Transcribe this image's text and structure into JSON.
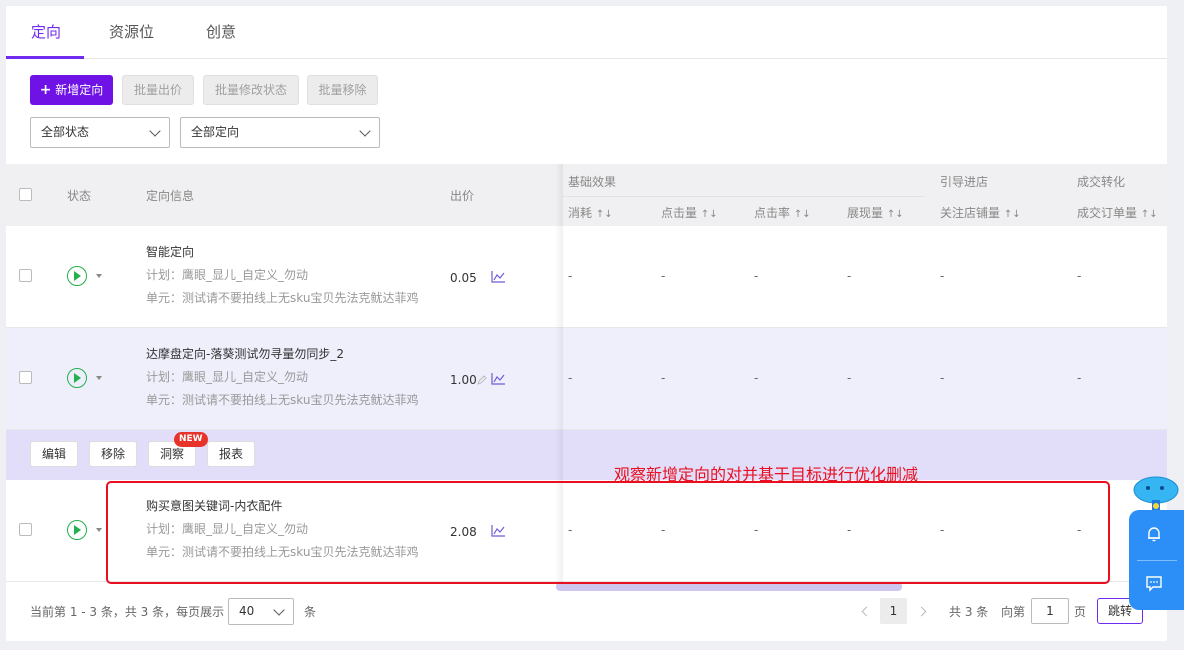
{
  "tabs": [
    {
      "label": "定向",
      "active": true
    },
    {
      "label": "资源位",
      "active": false
    },
    {
      "label": "创意",
      "active": false
    }
  ],
  "toolbar": {
    "add_label": "新增定向",
    "batch_bid": "批量出价",
    "batch_status": "批量修改状态",
    "batch_remove": "批量移除"
  },
  "filters": {
    "status_select": "全部状态",
    "targeting_select": "全部定向"
  },
  "table_header": {
    "status": "状态",
    "info": "定向信息",
    "bid": "出价",
    "group_basic": "基础效果",
    "group_guide": "引导进店",
    "group_conversion": "成交转化",
    "cost": "消耗",
    "clicks": "点击量",
    "ctr": "点击率",
    "impressions": "展现量",
    "follows": "关注店铺量",
    "orders": "成交订单量",
    "sort_glyph": "↑↓"
  },
  "rows": [
    {
      "title": "智能定向",
      "plan": "计划：鹰眼_显儿_自定义_勿动",
      "unit": "单元：测试请不要拍线上无sku宝贝先法克鱿达菲鸡",
      "price": "0.05",
      "cost": "-",
      "clicks": "-",
      "ctr": "-",
      "impressions": "-",
      "follows": "-",
      "orders": "-"
    },
    {
      "title": "达摩盘定向-落葵测试勿寻量勿同步_2",
      "plan": "计划：鹰眼_显儿_自定义_勿动",
      "unit": "单元：测试请不要拍线上无sku宝贝先法克鱿达菲鸡",
      "price": "1.00",
      "cost": "-",
      "clicks": "-",
      "ctr": "-",
      "impressions": "-",
      "follows": "-",
      "orders": "-"
    },
    {
      "title": "购买意图关键词-内衣配件",
      "plan": "计划：鹰眼_显儿_自定义_勿动",
      "unit": "单元：测试请不要拍线上无sku宝贝先法克鱿达菲鸡",
      "price": "2.08",
      "cost": "-",
      "clicks": "-",
      "ctr": "-",
      "impressions": "-",
      "follows": "-",
      "orders": "-"
    }
  ],
  "row_actions": {
    "edit": "编辑",
    "remove": "移除",
    "insight": "洞察",
    "new_badge": "NEW",
    "report": "报表"
  },
  "annotation": {
    "text": "观察新增定向的对并基于目标进行优化删减",
    "color": "#e81020"
  },
  "pagination": {
    "summary": "当前第 1 - 3 条，共 3 条，每页展示",
    "page_size": "40",
    "unit": "条",
    "current_page": "1",
    "total": "共 3 条",
    "goto_prefix": "向第",
    "goto_value": "1",
    "goto_suffix": "页",
    "jump_label": "跳转"
  },
  "colors": {
    "accent": "#6f2cf0",
    "primary_button": "#6f12e6",
    "status_green": "#22b14c",
    "float_blue": "#2b8ff7"
  },
  "icons": [
    "plus-icon",
    "chevron-down-icon",
    "play-status-icon",
    "chart-icon",
    "pencil-icon",
    "bell-icon",
    "message-icon",
    "mascot-icon"
  ]
}
